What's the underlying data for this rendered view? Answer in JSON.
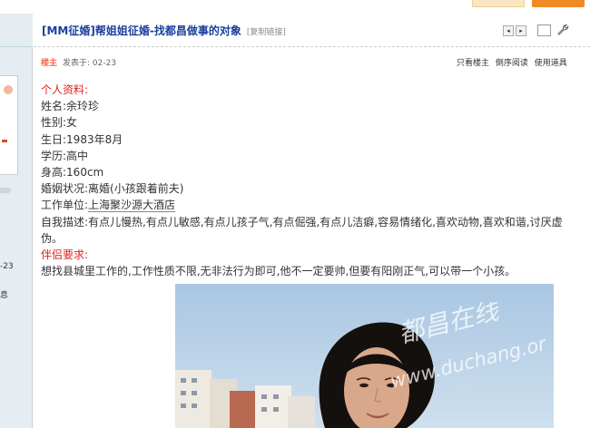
{
  "sidebar": {
    "date_fragment": "-23",
    "info_fragment": "息"
  },
  "post": {
    "title": "[MM征婚]帮姐姐征婚-找都昌做事的对象",
    "copy_link": "[复制链接]",
    "nav_prev": "◂",
    "nav_next": "▸",
    "author_badge": "楼主",
    "posted_at": "发表于: 02-23",
    "actions": "只看楼主 倒序阅读 使用道具"
  },
  "body": {
    "profile_heading": "个人资料:",
    "name": "姓名:余玲珍",
    "gender": "性别:女",
    "birthday": "生日:1983年8月",
    "education": "学历:高中",
    "height": "身高:160cm",
    "marital": "婚姻状况:离婚(小孩跟着前夫)",
    "work_prefix": "工作单位:",
    "work_place": "上海聚沙源大酒店",
    "self_desc": "自我描述:有点儿慢热,有点儿敏感,有点儿孩子气,有点倔强,有点儿洁癖,容易情绪化,喜欢动物,喜欢和谐,讨厌虚伪。",
    "partner_heading": "伴侣要求:",
    "partner_req": "想找县城里工作的,工作性质不限,无非法行为即可,他不一定要帅,但要有阳刚正气,可以带一个小孩。"
  },
  "photo": {
    "watermark_cn": "都昌在线",
    "watermark_url": "www.duchang.or"
  },
  "colors": {
    "title_blue": "#1b3f9c",
    "heading_red": "#e02222",
    "author_orange": "#f26c4f",
    "accent_orange": "#f08a24",
    "sidebar_bg": "#e5edf2"
  }
}
